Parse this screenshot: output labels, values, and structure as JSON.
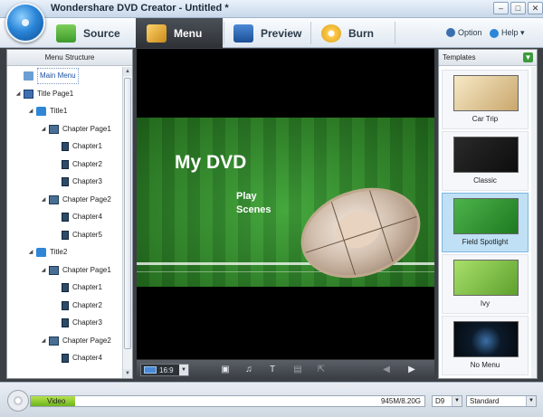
{
  "window": {
    "title": "Wondershare DVD Creator - Untitled *",
    "min": "–",
    "max": "□",
    "close": "✕"
  },
  "nav": {
    "tabs": [
      {
        "label": "Source",
        "icon": "source-icon"
      },
      {
        "label": "Menu",
        "icon": "menu-icon"
      },
      {
        "label": "Preview",
        "icon": "preview-icon"
      },
      {
        "label": "Burn",
        "icon": "burn-icon"
      }
    ],
    "option": "Option",
    "help": "Help ▾",
    "active_tab": "Menu",
    "colors": {
      "active_tab_bg": "#2e3237",
      "accent": "#2b86d8"
    }
  },
  "menu_structure": {
    "header": "Menu Structure",
    "items": [
      {
        "label": "Main Menu",
        "icon": "home-icon",
        "level": 0,
        "toggle": ""
      },
      {
        "label": "Title Page1",
        "icon": "page-icon",
        "level": 0,
        "toggle": "◢"
      },
      {
        "label": "Title1",
        "icon": "folder-icon",
        "level": 1,
        "toggle": "◢"
      },
      {
        "label": "Chapter Page1",
        "icon": "film-icon",
        "level": 2,
        "toggle": "◢"
      },
      {
        "label": "Chapter1",
        "icon": "chapter-icon",
        "level": 3,
        "toggle": ""
      },
      {
        "label": "Chapter2",
        "icon": "chapter-icon",
        "level": 3,
        "toggle": ""
      },
      {
        "label": "Chapter3",
        "icon": "chapter-icon",
        "level": 3,
        "toggle": ""
      },
      {
        "label": "Chapter Page2",
        "icon": "film-icon",
        "level": 2,
        "toggle": "◢"
      },
      {
        "label": "Chapter4",
        "icon": "chapter-icon",
        "level": 3,
        "toggle": ""
      },
      {
        "label": "Chapter5",
        "icon": "chapter-icon",
        "level": 3,
        "toggle": ""
      },
      {
        "label": "Title2",
        "icon": "folder-icon",
        "level": 1,
        "toggle": "◢"
      },
      {
        "label": "Chapter Page1",
        "icon": "film-icon",
        "level": 2,
        "toggle": "◢"
      },
      {
        "label": "Chapter1",
        "icon": "chapter-icon",
        "level": 3,
        "toggle": ""
      },
      {
        "label": "Chapter2",
        "icon": "chapter-icon",
        "level": 3,
        "toggle": ""
      },
      {
        "label": "Chapter3",
        "icon": "chapter-icon",
        "level": 3,
        "toggle": ""
      },
      {
        "label": "Chapter Page2",
        "icon": "film-icon",
        "level": 2,
        "toggle": "◢"
      },
      {
        "label": "Chapter4",
        "icon": "chapter-icon",
        "level": 3,
        "toggle": ""
      }
    ]
  },
  "preview": {
    "dvd_title": "My DVD",
    "play_line1": "Play",
    "play_line2": "Scenes",
    "aspect": "16:9",
    "toolbar_icons": [
      "thumbnail-icon",
      "music-icon",
      "text-icon",
      "copy-icon",
      "export-icon",
      "back-arrow-icon",
      "forward-arrow-icon"
    ]
  },
  "templates": {
    "header": "Templates",
    "download_icon": "download-icon",
    "items": [
      {
        "label": "Car Trip",
        "selected": false
      },
      {
        "label": "Classic",
        "selected": false
      },
      {
        "label": "Field Spotlight",
        "selected": true
      },
      {
        "label": "Ivy",
        "selected": false
      },
      {
        "label": "No Menu",
        "selected": false
      }
    ]
  },
  "status": {
    "video_label": "Video",
    "size": "945M/8.20G",
    "usage_fraction": 0.113,
    "disc_type": "D9",
    "quality": "Standard"
  }
}
